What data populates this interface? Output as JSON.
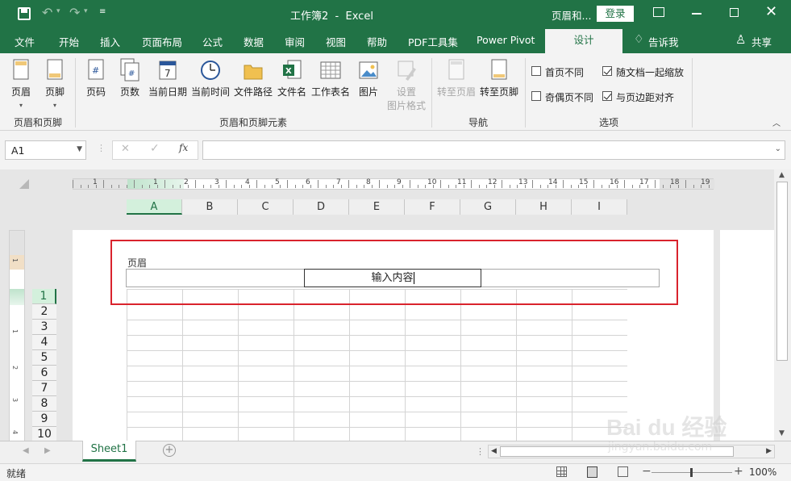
{
  "titlebar": {
    "doc_title": "工作簿2  -  Excel",
    "context_label": "页眉和...",
    "login_label": "登录"
  },
  "tabs": [
    "文件",
    "开始",
    "插入",
    "页面布局",
    "公式",
    "数据",
    "审阅",
    "视图",
    "帮助",
    "PDF工具集",
    "Power Pivot",
    "设计"
  ],
  "tell_me": "告诉我",
  "share": "共享",
  "ribbon": {
    "header_label": "页眉",
    "footer_label": "页脚",
    "group1": "页眉和页脚",
    "elements": [
      "页码",
      "页数",
      "当前日期",
      "当前时间",
      "文件路径",
      "文件名",
      "工作表名",
      "图片"
    ],
    "format_picture_l1": "设置",
    "format_picture_l2": "图片格式",
    "group2": "页眉和页脚元素",
    "goto_header": "转至页眉",
    "goto_footer": "转至页脚",
    "group3": "导航",
    "options": [
      {
        "label": "首页不同",
        "checked": false
      },
      {
        "label": "随文档一起缩放",
        "checked": true
      },
      {
        "label": "奇偶页不同",
        "checked": false
      },
      {
        "label": "与页边距对齐",
        "checked": true
      }
    ],
    "group4": "选项"
  },
  "formula": {
    "namebox": "A1",
    "fx": "fx",
    "value": ""
  },
  "ruler_numbers": [
    "1",
    "1",
    "2",
    "3",
    "4",
    "5",
    "6",
    "7",
    "8",
    "9",
    "10",
    "11",
    "12",
    "13",
    "14",
    "15",
    "16",
    "17",
    "18",
    "19"
  ],
  "columns": [
    "A",
    "B",
    "C",
    "D",
    "E",
    "F",
    "G",
    "H",
    "I"
  ],
  "rows": [
    "1",
    "2",
    "3",
    "4",
    "5",
    "6",
    "7",
    "8",
    "9",
    "10"
  ],
  "header_area": {
    "label": "页眉",
    "center_text": "输入内容"
  },
  "sheet_tab": "Sheet1",
  "status": {
    "ready": "就绪",
    "zoom": "100%"
  },
  "watermark": "Bai du 经验",
  "watermark_url": "jingyan.baidu.com",
  "colors": {
    "accent": "#217346",
    "highlight": "#d9232d"
  }
}
